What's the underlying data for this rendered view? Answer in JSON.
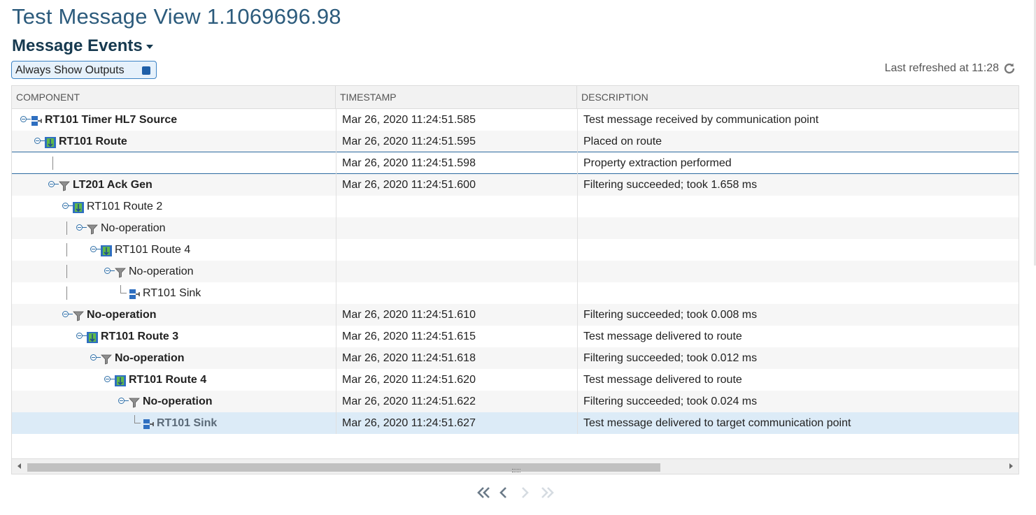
{
  "page": {
    "title": "Test Message View 1.1069696.98"
  },
  "section": {
    "title": "Message Events"
  },
  "toggle": {
    "label": "Always Show Outputs"
  },
  "refresh": {
    "text": "Last refreshed at 11:28"
  },
  "grid": {
    "columns": [
      "COMPONENT",
      "TIMESTAMP",
      "DESCRIPTION"
    ],
    "rows": [
      {
        "name": "RT101 Timer HL7 Source",
        "icon": "comm-point-icon",
        "timestamp": "Mar 26, 2020 11:24:51.585",
        "description": "Test message received by communication point"
      },
      {
        "name": "RT101 Route",
        "icon": "route-icon",
        "timestamp": "Mar 26, 2020 11:24:51.595",
        "description": "Placed on route"
      },
      {
        "name": "",
        "icon": "",
        "timestamp": "Mar 26, 2020 11:24:51.598",
        "description": "Property extraction performed"
      },
      {
        "name": "LT201 Ack Gen",
        "icon": "filter-icon",
        "timestamp": "Mar 26, 2020 11:24:51.600",
        "description": "Filtering succeeded; took 1.658 ms"
      },
      {
        "name": "RT101 Route 2",
        "icon": "route-icon",
        "timestamp": "",
        "description": ""
      },
      {
        "name": "No-operation",
        "icon": "filter-icon",
        "timestamp": "",
        "description": ""
      },
      {
        "name": "RT101 Route 4",
        "icon": "route-icon",
        "timestamp": "",
        "description": ""
      },
      {
        "name": "No-operation",
        "icon": "filter-icon",
        "timestamp": "",
        "description": ""
      },
      {
        "name": "RT101 Sink",
        "icon": "comm-point-icon",
        "timestamp": "",
        "description": ""
      },
      {
        "name": "No-operation",
        "icon": "filter-icon",
        "timestamp": "Mar 26, 2020 11:24:51.610",
        "description": "Filtering succeeded; took 0.008 ms"
      },
      {
        "name": "RT101 Route 3",
        "icon": "route-icon",
        "timestamp": "Mar 26, 2020 11:24:51.615",
        "description": "Test message delivered to route"
      },
      {
        "name": "No-operation",
        "icon": "filter-icon",
        "timestamp": "Mar 26, 2020 11:24:51.618",
        "description": "Filtering succeeded; took 0.012 ms"
      },
      {
        "name": "RT101 Route 4",
        "icon": "route-icon",
        "timestamp": "Mar 26, 2020 11:24:51.620",
        "description": "Test message delivered to route"
      },
      {
        "name": "No-operation",
        "icon": "filter-icon",
        "timestamp": "Mar 26, 2020 11:24:51.622",
        "description": "Filtering succeeded; took 0.024 ms"
      },
      {
        "name": "RT101 Sink",
        "icon": "comm-point-icon",
        "timestamp": "Mar 26, 2020 11:24:51.627",
        "description": "Test message delivered to target communication point"
      }
    ]
  },
  "pager": {
    "icons": [
      "first-page-icon",
      "previous-page-icon",
      "next-page-icon",
      "last-page-icon"
    ]
  },
  "colors": {
    "title": "#2c5b7c",
    "section": "#16394f",
    "accent": "#1f5fa8",
    "selected_row": "#dcebf7"
  }
}
